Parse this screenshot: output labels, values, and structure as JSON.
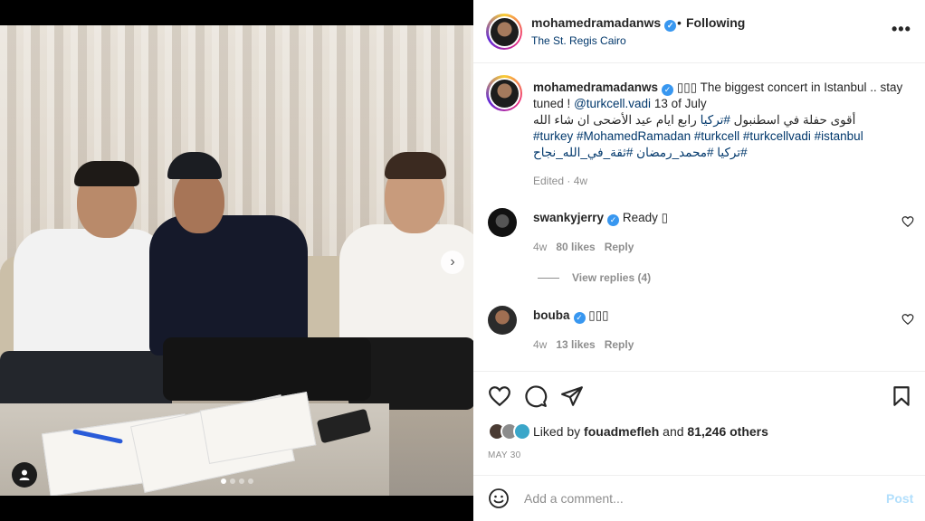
{
  "post": {
    "username": "mohamedramadanws",
    "follow_status": "Following",
    "location": "The St. Regis Cairo",
    "more_icon": "more-icon",
    "caption": {
      "emojis": "▯▯▯",
      "text_en": "The biggest concert in Istanbul .. stay tuned !",
      "mention": "@turkcell.vadi",
      "date_text": "13 of July",
      "arabic_line1": "أقوى حفلة في اسطنبول",
      "arabic_tag1": "#تركيا",
      "arabic_line1_end": "رابع ايام عيد الأضحى ان شاء الله",
      "hashtags_en": "#turkey #MohamedRamadan #turkcell #turkcellvadi #istanbul",
      "hashtags_ar": "#تركيا #محمد_رمضان #ثقة_في_الله_نجاح",
      "edited": "Edited · 4w"
    }
  },
  "comments": [
    {
      "username": "swankyjerry",
      "text": "Ready ▯",
      "time": "4w",
      "likes": "80 likes",
      "reply": "Reply"
    },
    {
      "username": "bouba",
      "text": "▯▯▯",
      "time": "4w",
      "likes": "13 likes",
      "reply": "Reply"
    }
  ],
  "view_replies": "View replies (4)",
  "likes": {
    "prefix": "Liked by",
    "user": "fouadmefleh",
    "and": "and",
    "others": "81,246 others"
  },
  "date": "MAY 30",
  "comment_box": {
    "placeholder": "Add a comment...",
    "post_label": "Post"
  },
  "carousel": {
    "total": 4,
    "active": 0
  },
  "colors": {
    "link": "#00376b",
    "verified": "#3897f0",
    "post_disabled": "#b2dffc"
  }
}
